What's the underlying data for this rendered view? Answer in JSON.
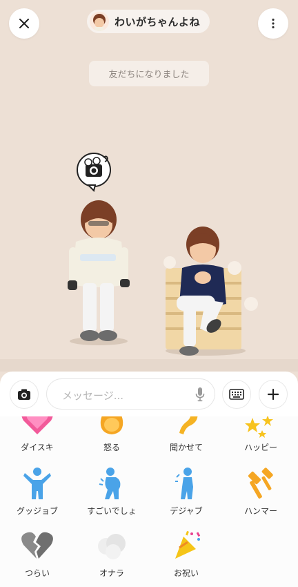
{
  "header": {
    "chat_name": "わいがちゃんよね",
    "close_icon": "close-icon",
    "more_icon": "more-vertical-icon"
  },
  "scene": {
    "system_message": "友だちになりました"
  },
  "composer": {
    "placeholder": "メッセージ...",
    "camera_icon": "camera-icon",
    "mic_icon": "mic-icon",
    "keyboard_icon": "keyboard-icon",
    "plus_icon": "plus-icon"
  },
  "stickers": [
    {
      "label": "ダイスキ",
      "icon": "heart-icon"
    },
    {
      "label": "怒る",
      "icon": "angry-fire-icon"
    },
    {
      "label": "聞かせて",
      "icon": "ear-icon"
    },
    {
      "label": "ハッピー",
      "icon": "happy-sparkle-icon"
    },
    {
      "label": "グッジョブ",
      "icon": "good-job-figure-icon"
    },
    {
      "label": "すごいでしょ",
      "icon": "proud-figure-icon"
    },
    {
      "label": "デジャブ",
      "icon": "dejavu-figure-icon"
    },
    {
      "label": "ハンマー",
      "icon": "hammer-icon"
    },
    {
      "label": "つらい",
      "icon": "broken-heart-icon"
    },
    {
      "label": "オナラ",
      "icon": "fart-cloud-icon"
    },
    {
      "label": "お祝い",
      "icon": "party-popper-icon"
    }
  ]
}
